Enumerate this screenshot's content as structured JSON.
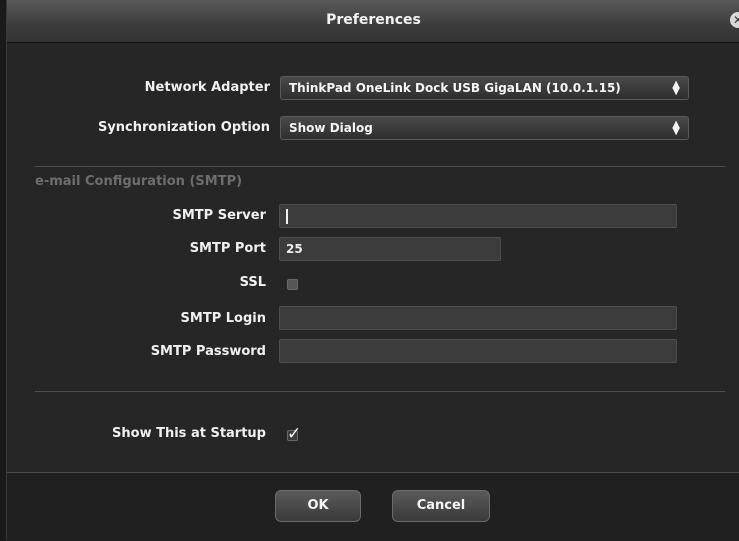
{
  "window": {
    "title": "Preferences",
    "close_glyph": "✕"
  },
  "network": {
    "label": "Network Adapter",
    "value": "ThinkPad OneLink Dock USB GigaLAN (10.0.1.15)"
  },
  "sync": {
    "label": "Synchronization Option",
    "value": "Show Dialog"
  },
  "select_arrows": "▲\n▼",
  "smtp": {
    "section_title": "e-mail Configuration (SMTP)",
    "server_label": "SMTP Server",
    "server_value": "",
    "port_label": "SMTP Port",
    "port_value": "25",
    "ssl_label": "SSL",
    "ssl_checked": false,
    "login_label": "SMTP Login",
    "login_value": "",
    "password_label": "SMTP Password",
    "password_value": ""
  },
  "startup": {
    "label": "Show This at Startup",
    "checked": true,
    "check_glyph": "✓"
  },
  "buttons": {
    "ok": "OK",
    "cancel": "Cancel"
  }
}
